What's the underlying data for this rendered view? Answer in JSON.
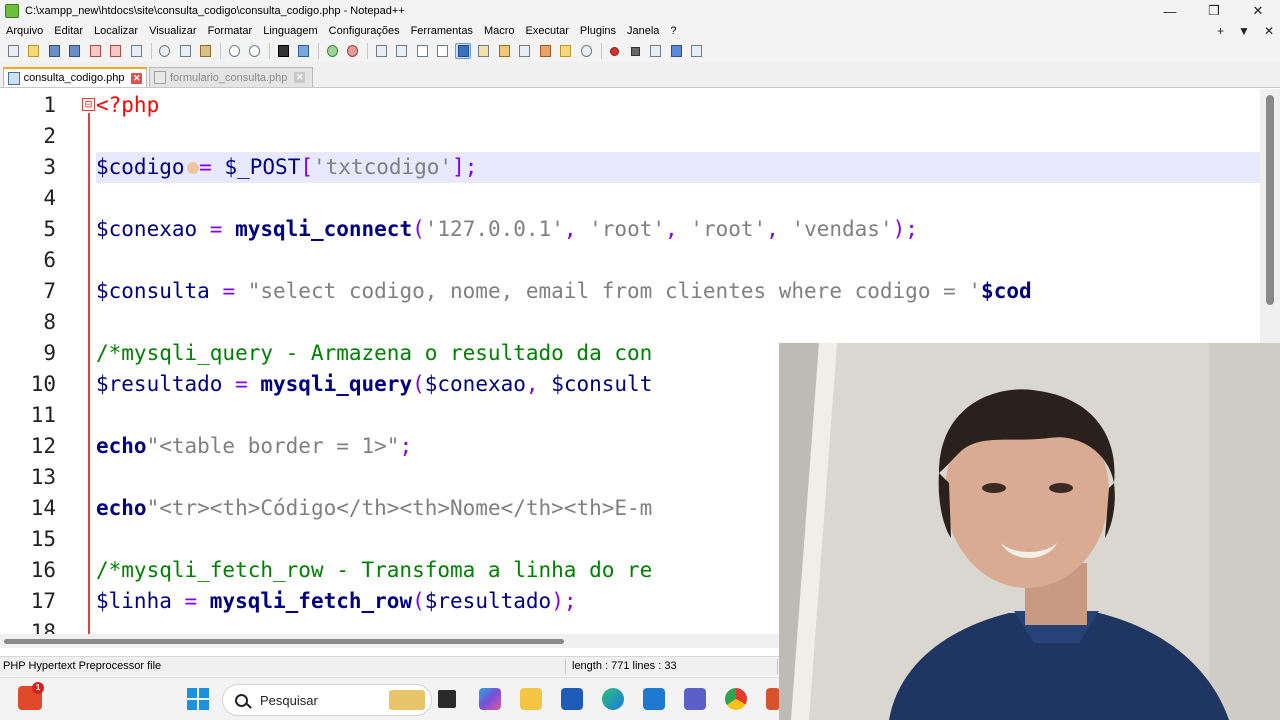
{
  "window": {
    "title": "C:\\xampp_new\\htdocs\\site\\consulta_codigo\\consulta_codigo.php - Notepad++",
    "minimize": "—",
    "maximize": "❐",
    "close": "✕"
  },
  "menu": {
    "items": [
      "Arquivo",
      "Editar",
      "Localizar",
      "Visualizar",
      "Formatar",
      "Linguagem",
      "Configurações",
      "Ferramentas",
      "Macro",
      "Executar",
      "Plugins",
      "Janela",
      "?"
    ],
    "right": [
      "+",
      "▼",
      "✕"
    ]
  },
  "tabs": [
    {
      "label": "consulta_codigo.php",
      "active": true,
      "close": "✕"
    },
    {
      "label": "formulario_consulta.php",
      "active": false,
      "close": "✕"
    }
  ],
  "fold_marker": "⊟",
  "editor": {
    "lines": [
      "1",
      "2",
      "3",
      "4",
      "5",
      "6",
      "7",
      "8",
      "9",
      "10",
      "11",
      "12",
      "13",
      "14",
      "15",
      "16",
      "17",
      "18"
    ],
    "current_line": 3,
    "code": {
      "l1_tag": "<?php",
      "l3_var": "$codigo",
      "l3_op": "=",
      "l3_post": "$_POST",
      "l3_bracket_open": "[",
      "l3_key": "'txtcodigo'",
      "l3_bracket_close": "];",
      "l5_var": "$conexao",
      "l5_op": " = ",
      "l5_fn": "mysqli_connect",
      "l5_open": "(",
      "l5_a1": "'127.0.0.1'",
      "l5_c1": ", ",
      "l5_a2": "'root'",
      "l5_c2": ", ",
      "l5_a3": "'root'",
      "l5_c3": ", ",
      "l5_a4": "'vendas'",
      "l5_close": ");",
      "l7_var": "$consulta",
      "l7_op": " = ",
      "l7_str": "\"select codigo, nome, email from clientes where codigo = '",
      "l7_svar": "$cod",
      "l9_cmt": "/*mysqli_query - Armazena o resultado da con",
      "l10_var": "$resultado",
      "l10_op": " = ",
      "l10_fn": "mysqli_query",
      "l10_open": "(",
      "l10_a1": "$conexao",
      "l10_c1": ", ",
      "l10_a2": "$consult",
      "l12_kw": "echo",
      "l12_str": "\"<table border = 1>\"",
      "l12_end": ";",
      "l14_kw": "echo",
      "l14_str": "\"<tr><th>Código</th><th>Nome</th><th>E-m",
      "l16_cmt": "/*mysqli_fetch_row - Transfoma a linha do re",
      "l17_var": "$linha",
      "l17_op": " = ",
      "l17_fn": "mysqli_fetch_row",
      "l17_open": "(",
      "l17_a1": "$resultado",
      "l17_close": ");"
    }
  },
  "status": {
    "file_type": "PHP Hypertext Preprocessor file",
    "length": "length : 771    lines : 33"
  },
  "taskbar": {
    "search_label": "Pesquisar",
    "badge": "1"
  },
  "colors": {
    "variable": "#000080",
    "operator": "#8000ff",
    "string": "#808080",
    "function": "#000080",
    "comment": "#008000",
    "php_tag": "#ff0000",
    "current_line": "#e8e8ff",
    "fold_line": "#e04040"
  }
}
